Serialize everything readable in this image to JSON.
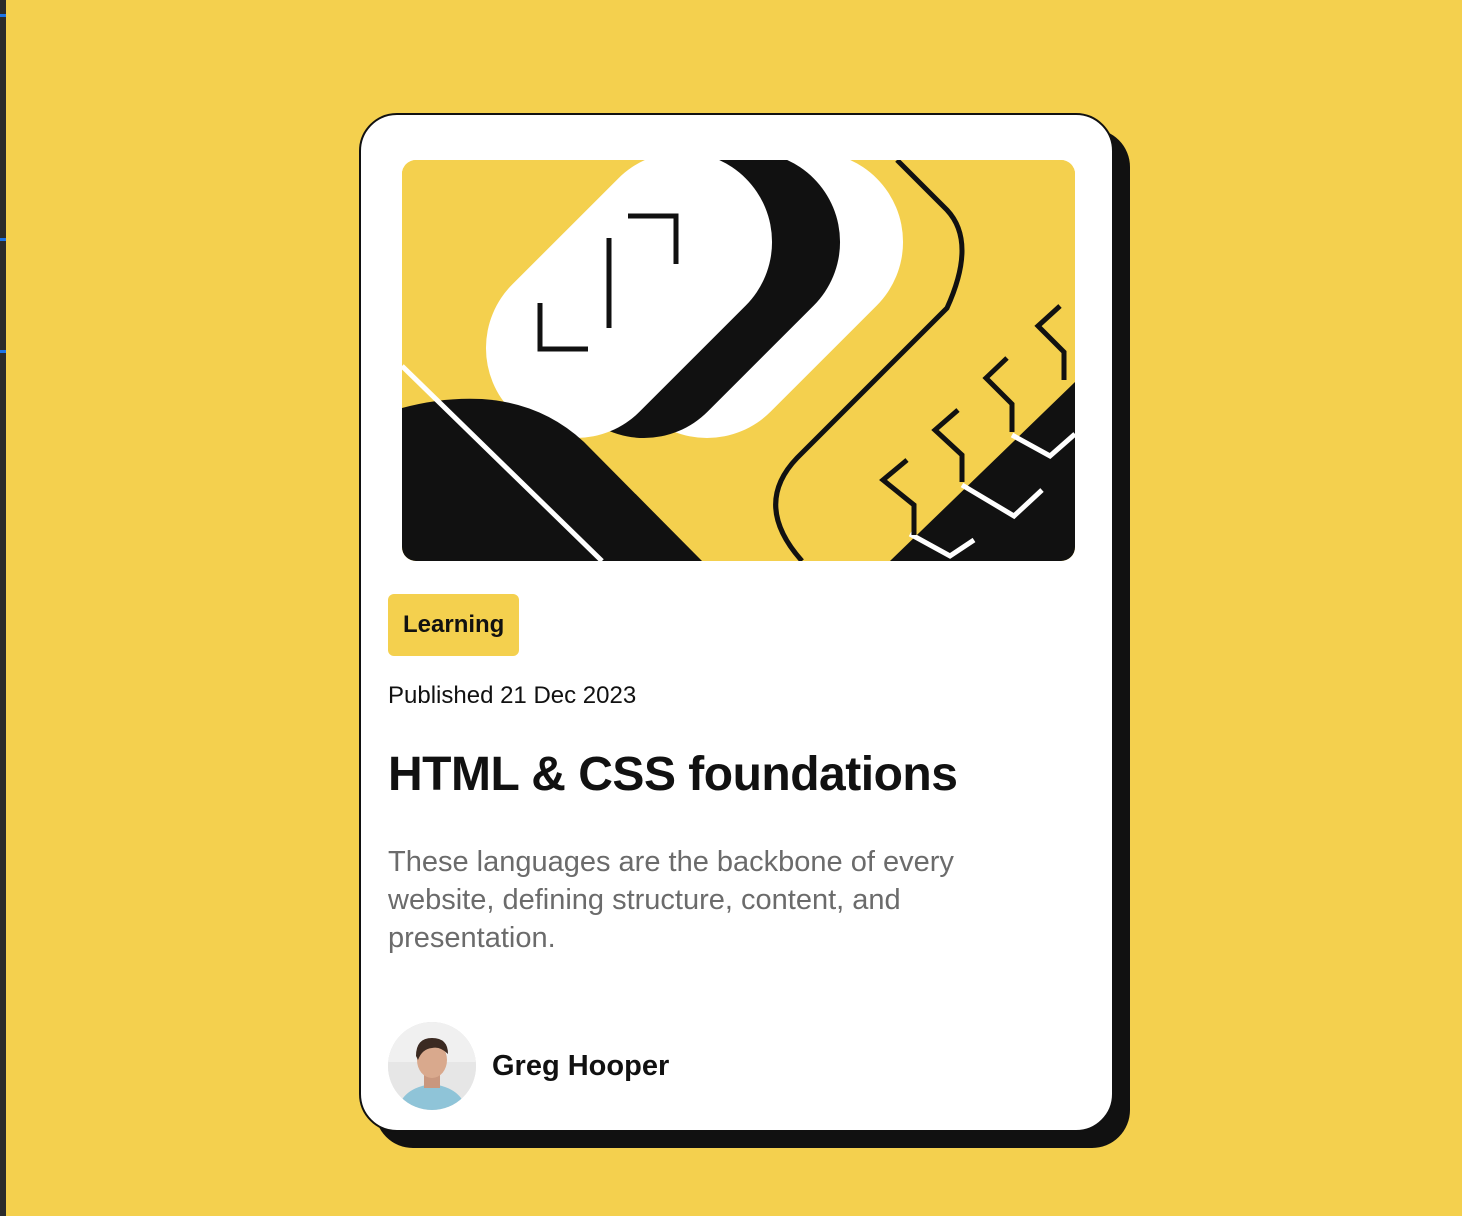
{
  "theme": {
    "background": "#f4d04e",
    "card": "#ffffff",
    "ink": "#111111",
    "muted": "#6b6b6b"
  },
  "card": {
    "hero_image_icon": "abstract-illustration-icon",
    "tag_label": "Learning",
    "published": "Published 21 Dec 2023",
    "title": "HTML & CSS foundations",
    "description": "These languages are the backbone of every website, defining structure, content, and presentation.",
    "author": {
      "name": "Greg Hooper",
      "avatar_icon": "avatar-icon"
    }
  }
}
